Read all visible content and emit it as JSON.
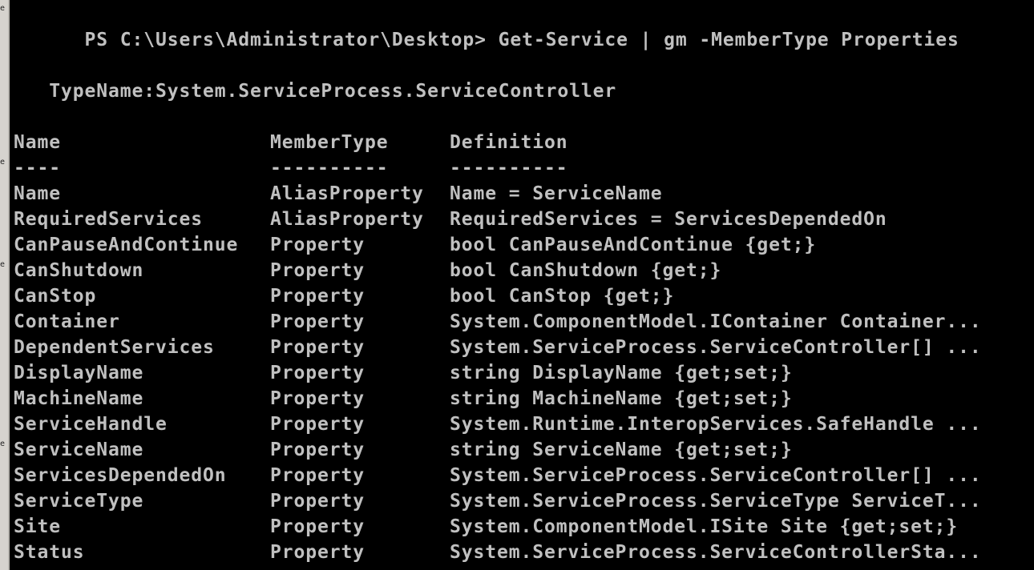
{
  "prompt": {
    "path": "PS C:\\Users\\Administrator\\Desktop>",
    "command": " Get-Service | gm -MemberType Properties"
  },
  "type_name": "   TypeName:System.ServiceProcess.ServiceController",
  "table": {
    "headers": {
      "name": "Name",
      "member_type": "MemberType",
      "definition": "Definition"
    },
    "underlines": {
      "name": "----",
      "member_type": "----------",
      "definition": "----------"
    },
    "rows": [
      {
        "name": "Name",
        "member_type": "AliasProperty",
        "definition": "Name = ServiceName"
      },
      {
        "name": "RequiredServices",
        "member_type": "AliasProperty",
        "definition": "RequiredServices = ServicesDependedOn"
      },
      {
        "name": "CanPauseAndContinue",
        "member_type": "Property",
        "definition": "bool CanPauseAndContinue {get;}"
      },
      {
        "name": "CanShutdown",
        "member_type": "Property",
        "definition": "bool CanShutdown {get;}"
      },
      {
        "name": "CanStop",
        "member_type": "Property",
        "definition": "bool CanStop {get;}"
      },
      {
        "name": "Container",
        "member_type": "Property",
        "definition": "System.ComponentModel.IContainer Container..."
      },
      {
        "name": "DependentServices",
        "member_type": "Property",
        "definition": "System.ServiceProcess.ServiceController[] ..."
      },
      {
        "name": "DisplayName",
        "member_type": "Property",
        "definition": "string DisplayName {get;set;}"
      },
      {
        "name": "MachineName",
        "member_type": "Property",
        "definition": "string MachineName {get;set;}"
      },
      {
        "name": "ServiceHandle",
        "member_type": "Property",
        "definition": "System.Runtime.InteropServices.SafeHandle ..."
      },
      {
        "name": "ServiceName",
        "member_type": "Property",
        "definition": "string ServiceName {get;set;}"
      },
      {
        "name": "ServicesDependedOn",
        "member_type": "Property",
        "definition": "System.ServiceProcess.ServiceController[] ..."
      },
      {
        "name": "ServiceType",
        "member_type": "Property",
        "definition": "System.ServiceProcess.ServiceType ServiceT..."
      },
      {
        "name": "Site",
        "member_type": "Property",
        "definition": "System.ComponentModel.ISite Site {get;set;}"
      },
      {
        "name": "Status",
        "member_type": "Property",
        "definition": "System.ServiceProcess.ServiceControllerSta..."
      }
    ]
  },
  "colors": {
    "background": "#000000",
    "text": "#c0c0c0"
  }
}
